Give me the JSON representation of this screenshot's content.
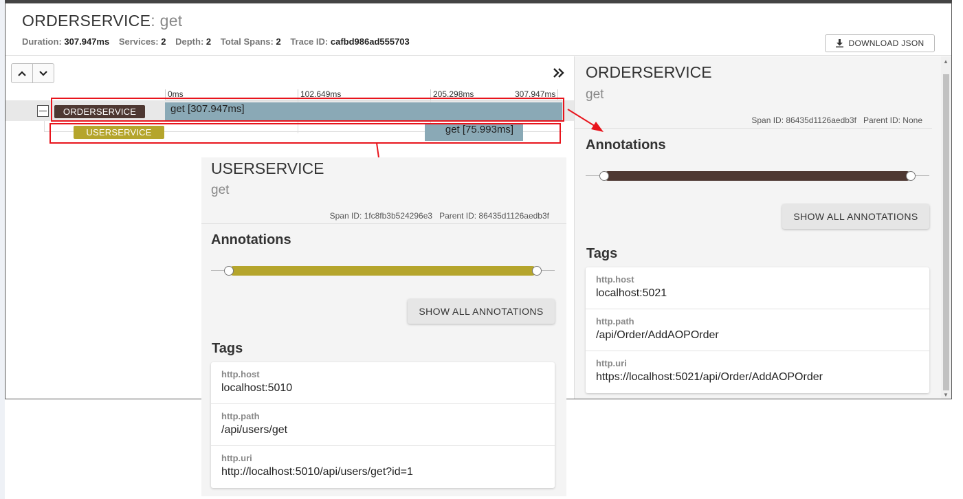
{
  "header": {
    "service": "ORDERSERVICE",
    "operation": ": get",
    "duration_label": "Duration:",
    "duration": "307.947ms",
    "services_label": "Services:",
    "services": "2",
    "depth_label": "Depth:",
    "depth": "2",
    "total_spans_label": "Total Spans:",
    "total_spans": "2",
    "trace_id_label": "Trace ID:",
    "trace_id": "cafbd986ad555703",
    "download_label": "DOWNLOAD JSON"
  },
  "nav": {
    "up_icon": "chevron-up-icon",
    "down_icon": "chevron-down-icon",
    "expand_icon": "double-chevron-right-icon"
  },
  "timeline_ticks": [
    "0ms",
    "102.649ms",
    "205.298ms",
    "307.947ms"
  ],
  "spans": [
    {
      "service": "ORDERSERVICE",
      "label": "get [307.947ms]",
      "color": "#4e3832",
      "start_ms": 0,
      "duration_ms": 307.947
    },
    {
      "service": "USERSERVICE",
      "label": "get [75.993ms]",
      "color": "#b5a52c",
      "start_ms": 200.5,
      "duration_ms": 75.993
    }
  ],
  "order_detail": {
    "service": "ORDERSERVICE",
    "operation": "get",
    "span_id": "Span ID: 86435d1126aedb3f",
    "parent_id": "Parent ID: None",
    "annotations_title": "Annotations",
    "annotation_color": "#4e3832",
    "show_all": "SHOW ALL ANNOTATIONS",
    "tags_title": "Tags",
    "tags": [
      {
        "key": "http.host",
        "value": "localhost:5021"
      },
      {
        "key": "http.path",
        "value": "/api/Order/AddAOPOrder"
      },
      {
        "key": "http.uri",
        "value": "https://localhost:5021/api/Order/AddAOPOrder"
      }
    ]
  },
  "user_detail": {
    "service": "USERSERVICE",
    "operation": "get",
    "span_id": "Span ID: 1fc8fb3b524296e3",
    "parent_id": "Parent ID: 86435d1126aedb3f",
    "annotations_title": "Annotations",
    "annotation_color": "#b5a52c",
    "show_all": "SHOW ALL ANNOTATIONS",
    "tags_title": "Tags",
    "tags": [
      {
        "key": "http.host",
        "value": "localhost:5010"
      },
      {
        "key": "http.path",
        "value": "/api/users/get"
      },
      {
        "key": "http.uri",
        "value": "http://localhost:5010/api/users/get?id=1"
      }
    ]
  }
}
